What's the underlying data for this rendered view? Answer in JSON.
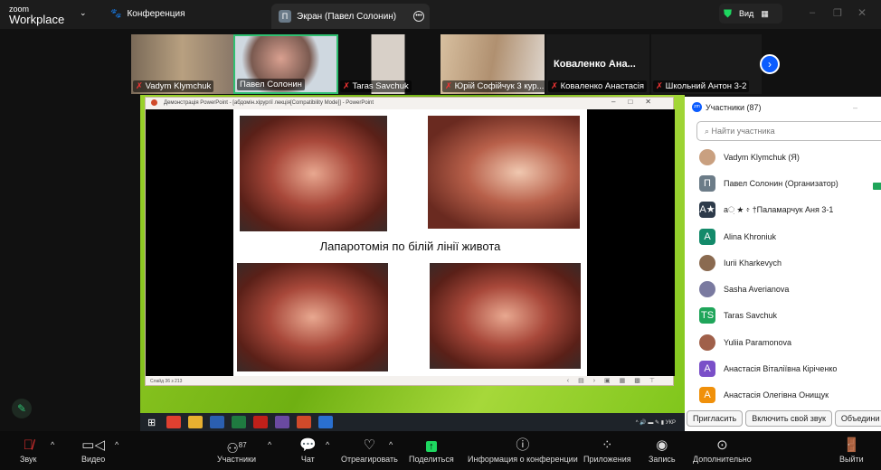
{
  "header": {
    "logo_small": "zoom",
    "logo_big": "Workplace",
    "meeting_label": "Конференция",
    "share_tab": "Экран (Павел Солонин)",
    "share_tab_avatar": "П",
    "view_label": "Вид"
  },
  "thumbnails": [
    {
      "name": "Vadym Klymchuk"
    },
    {
      "name": "Павел Солонин"
    },
    {
      "name": "Taras Savchuk"
    },
    {
      "name": "Юрій Софійчук 3 кур..."
    },
    {
      "name": "Коваленко Анастасія",
      "big_name": "Коваленко Ана..."
    },
    {
      "name": "Школьний Антон 3-2"
    }
  ],
  "powerpoint": {
    "title": "Демонстрація PowerPoint - [абдомін.хірургії лекція[Compatibility Mode]] - PowerPoint",
    "slide_title": "Лапаротомія по білій лінії живота",
    "status": "Слайд 36 з 213"
  },
  "taskbar": {
    "lang": "УКР"
  },
  "participants": {
    "title": "Участники (87)",
    "search_placeholder": "Найти участника",
    "list": [
      {
        "name": "Vadym Klymchuk (Я)",
        "avatar": "",
        "color": "#c9a080"
      },
      {
        "name": "Павел Солонин (Организатор)",
        "avatar": "П",
        "color": "#6c7c88"
      },
      {
        "name": "а਼ ★ ፥ †Паламарчук Аня 3-1",
        "avatar": "A★",
        "color": "#2d3a4a"
      },
      {
        "name": "Alina Khroniuk",
        "avatar": "A",
        "color": "#138a6a"
      },
      {
        "name": "Iurii Kharkevych",
        "avatar": "",
        "color": "#8a6a50"
      },
      {
        "name": "Sasha Averianova",
        "avatar": "",
        "color": "#7a7aa0"
      },
      {
        "name": "Taras Savchuk",
        "avatar": "TS",
        "color": "#1fa55a"
      },
      {
        "name": "Yuliia Paramonova",
        "avatar": "",
        "color": "#a0604a"
      },
      {
        "name": "Анастасія Віталіївна Кіріченко",
        "avatar": "A",
        "color": "#7a4fc8"
      },
      {
        "name": "Анастасія Олегівна Онищук",
        "avatar": "A",
        "color": "#f0900a"
      }
    ],
    "buttons": {
      "invite": "Пригласить",
      "unmute": "Включить свой звук",
      "merge": "Объедини"
    }
  },
  "toolbar": {
    "audio": "Звук",
    "video": "Видео",
    "participants": "Участники",
    "participants_count": "87",
    "chat": "Чат",
    "react": "Отреагировать",
    "share": "Поделиться",
    "info": "Информация о конференции",
    "apps": "Приложения",
    "record": "Запись",
    "more": "Дополнительно",
    "leave": "Выйти"
  },
  "colors": {
    "accent": "#0b5cff",
    "share_green": "#1ed760",
    "active_border": "#2fbf71"
  }
}
